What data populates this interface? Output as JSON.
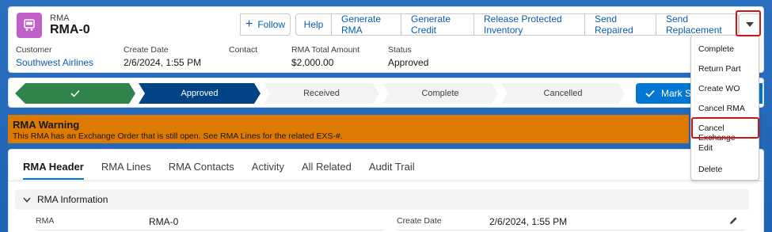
{
  "record": {
    "object_type": "RMA",
    "title": "RMA-0"
  },
  "actions": {
    "follow": "Follow",
    "buttons": [
      "Help",
      "Generate RMA",
      "Generate Credit",
      "Release Protected Inventory",
      "Send Repaired",
      "Send Replacement"
    ]
  },
  "highlights": {
    "customer_label": "Customer",
    "customer_value": "Southwest Airlines",
    "create_date_label": "Create Date",
    "create_date_value": "2/6/2024, 1:55 PM",
    "contact_label": "Contact",
    "amount_label": "RMA Total Amount",
    "amount_value": "$2,000.00",
    "status_label": "Status",
    "status_value": "Approved"
  },
  "path": {
    "stages": [
      "",
      "Approved",
      "Received",
      "Complete",
      "Cancelled"
    ],
    "mark_button": "Mark Sta"
  },
  "warning": {
    "title": "RMA Warning",
    "text": "This RMA has an Exchange Order that is still open. See RMA Lines for the related EXS-#."
  },
  "tabs": [
    "RMA Header",
    "RMA Lines",
    "RMA Contacts",
    "Activity",
    "All Related",
    "Audit Trail"
  ],
  "section": {
    "title": "RMA Information",
    "rma_label": "RMA",
    "rma_value": "RMA-0",
    "create_date_label": "Create Date",
    "create_date_value": "2/6/2024, 1:55 PM"
  },
  "menu": {
    "items": [
      "Complete",
      "Return Part",
      "Create WO",
      "Cancel RMA",
      "Cancel Exchange",
      "Edit",
      "Delete"
    ]
  },
  "colors": {
    "accent": "#0176d3",
    "path_done": "#2e844a",
    "path_current": "#014486",
    "warning": "#dd7a01",
    "highlight_box": "#d01515",
    "object_icon": "#c05fc9"
  }
}
